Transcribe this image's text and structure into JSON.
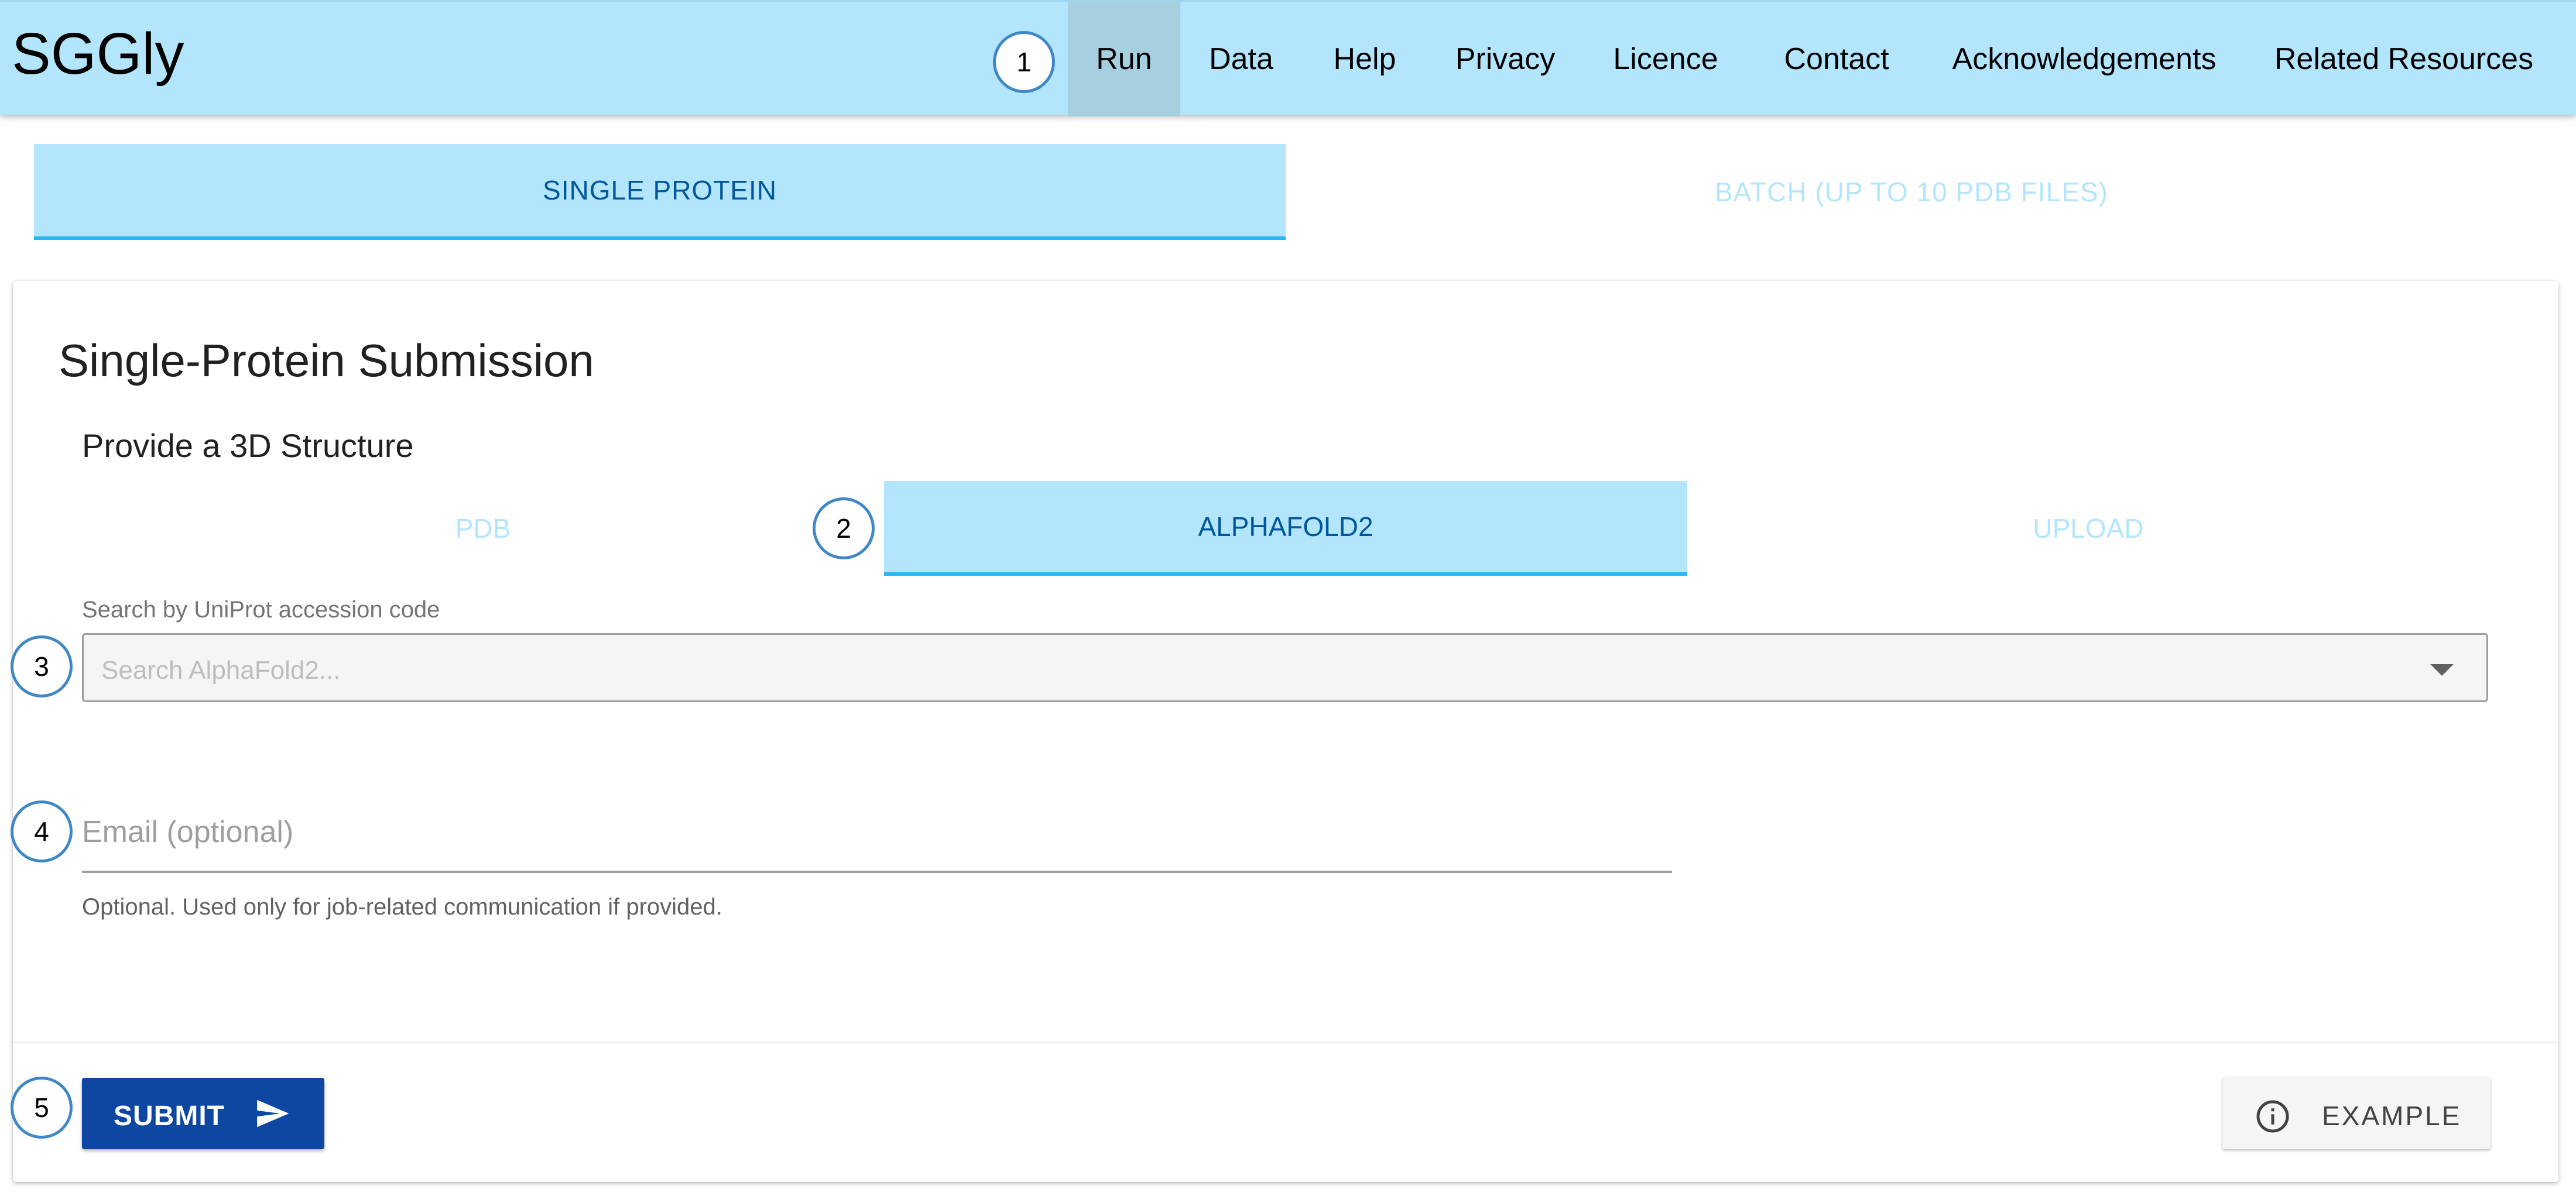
{
  "app": {
    "title": "SGGly"
  },
  "nav": {
    "items": [
      {
        "label": "Run",
        "active": true
      },
      {
        "label": "Data"
      },
      {
        "label": "Help"
      },
      {
        "label": "Privacy"
      },
      {
        "label": "Licence"
      },
      {
        "label": "Contact"
      },
      {
        "label": "Acknowledgements"
      },
      {
        "label": "Related Resources"
      }
    ]
  },
  "markers": [
    "1",
    "2",
    "3",
    "4",
    "5"
  ],
  "main_tabs": [
    {
      "label": "SINGLE PROTEIN",
      "active": true
    },
    {
      "label": "BATCH (UP TO 10 PDB FILES)",
      "active": false
    }
  ],
  "card": {
    "title": "Single-Protein Submission",
    "section_title": "Provide a 3D Structure",
    "structure_tabs": [
      {
        "label": "PDB",
        "active": false
      },
      {
        "label": "ALPHAFOLD2",
        "active": true
      },
      {
        "label": "UPLOAD",
        "active": false
      }
    ],
    "search": {
      "label": "Search by UniProt accession code",
      "placeholder": "Search AlphaFold2..."
    },
    "email": {
      "placeholder": "Email (optional)",
      "hint": "Optional. Used only for job-related communication if provided."
    },
    "submit_label": "SUBMIT",
    "example_label": "EXAMPLE"
  },
  "colors": {
    "header_bg": "#b3e5fc",
    "active_nav_bg": "#a6cfe0",
    "active_tab_text": "#01579b",
    "tab_underline": "#29b6f6",
    "submit_bg": "#0d47a1",
    "marker_ring": "#3f88c5"
  },
  "icons": {
    "submit": "send-icon",
    "example": "info-icon",
    "select": "chevron-down-icon"
  }
}
